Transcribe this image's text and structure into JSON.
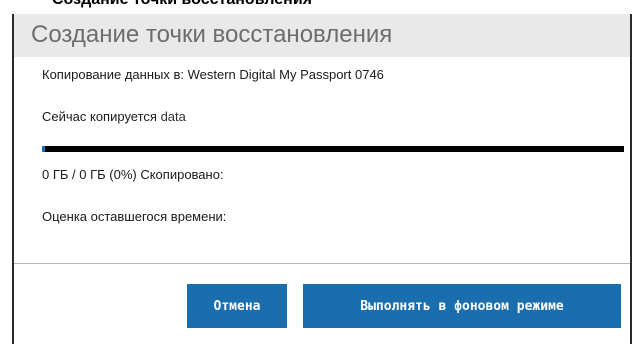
{
  "top_strip_text": "Создание точки восстановления",
  "dialog": {
    "title": "Создание точки восстановления",
    "copy_destination_label": "Копирование данных в:",
    "copy_destination_value": "Western Digital My Passport 0746",
    "current_label": "Сейчас копируется",
    "current_value": "data",
    "progress": {
      "fraction": 0.005,
      "text": "0 ГБ  /  0 ГБ (0%)  Скопировано:"
    },
    "time_remaining_label": "Оценка оставшегося времени:",
    "buttons": {
      "cancel": "Отмена",
      "background": "Выполнять в фоновом режиме"
    }
  }
}
